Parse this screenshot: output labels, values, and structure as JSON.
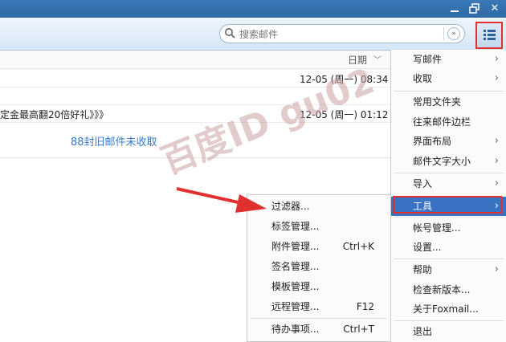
{
  "window": {
    "minimize_icon": "minimize-icon",
    "restore_icon": "restore-icon",
    "close_icon": "close-icon",
    "close_label": "✕"
  },
  "search": {
    "placeholder": "搜索邮件",
    "dropdown_label": "»"
  },
  "toolbar": {
    "menu_icon": "list-menu-icon"
  },
  "list": {
    "column_date": "日期",
    "rows": [
      {
        "subject": "",
        "time": "12-05 (周一) 08:34"
      },
      {
        "subject": "定金最高翻20倍好礼》》》",
        "time": "12-05 (周一) 01:12"
      }
    ],
    "older_notice": "88封旧邮件未收取"
  },
  "menu": {
    "items": [
      {
        "label": "写邮件",
        "arrow": true
      },
      {
        "label": "收取",
        "arrow": true
      },
      {
        "label": "常用文件夹",
        "arrow": false
      },
      {
        "label": "往来邮件边栏",
        "arrow": false
      },
      {
        "label": "界面布局",
        "arrow": true
      },
      {
        "label": "邮件文字大小",
        "arrow": true
      },
      {
        "label": "导入",
        "arrow": true
      },
      {
        "label": "工具",
        "arrow": true,
        "selected": true
      },
      {
        "label": "帐号管理...",
        "arrow": false
      },
      {
        "label": "设置...",
        "arrow": false
      },
      {
        "label": "帮助",
        "arrow": true
      },
      {
        "label": "检查新版本...",
        "arrow": false
      },
      {
        "label": "关于Foxmail...",
        "arrow": false
      },
      {
        "label": "退出",
        "arrow": false
      }
    ]
  },
  "submenu": {
    "items": [
      {
        "label": "过滤器...",
        "shortcut": ""
      },
      {
        "label": "标签管理...",
        "shortcut": ""
      },
      {
        "label": "附件管理...",
        "shortcut": "Ctrl+K"
      },
      {
        "label": "签名管理...",
        "shortcut": ""
      },
      {
        "label": "模板管理...",
        "shortcut": ""
      },
      {
        "label": "远程管理...",
        "shortcut": "F12"
      },
      {
        "label": "待办事项...",
        "shortcut": "Ctrl+T"
      }
    ]
  },
  "watermark": {
    "text": "百度ID gu02"
  },
  "colors": {
    "accent": "#3a72c4",
    "highlight_border": "#e03030",
    "link": "#3a7bc8"
  }
}
